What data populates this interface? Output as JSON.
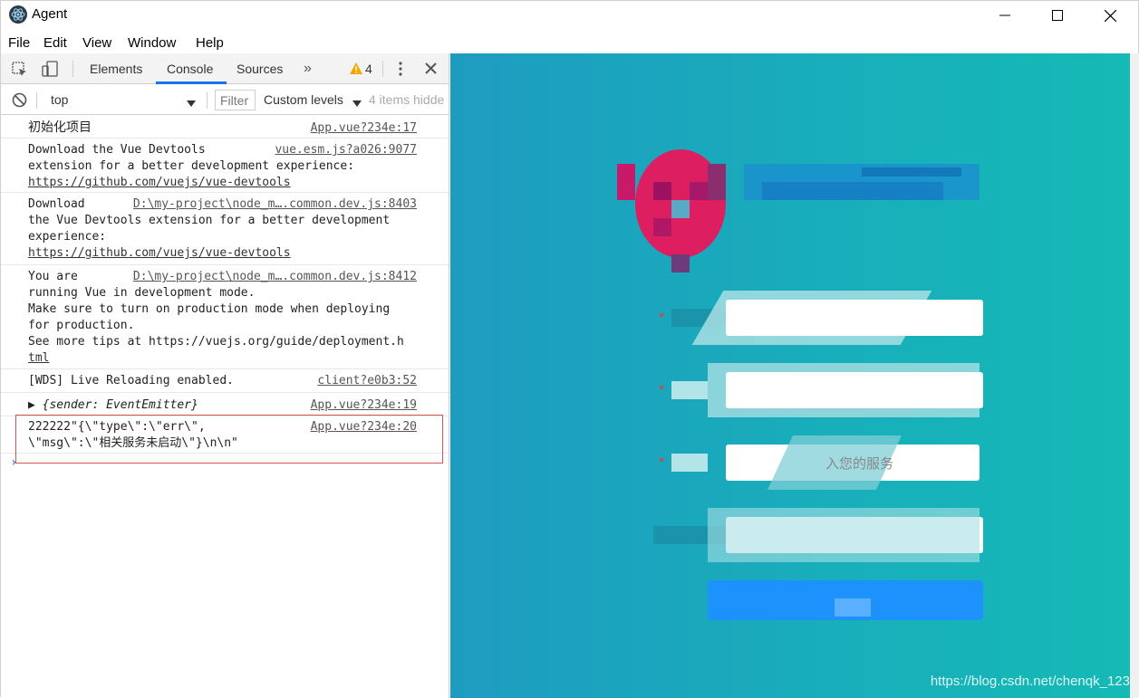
{
  "window": {
    "title": "Agent"
  },
  "menu": [
    "File",
    "Edit",
    "View",
    "Window",
    "Help"
  ],
  "devtools": {
    "tabs": [
      "Elements",
      "Console",
      "Sources"
    ],
    "active_tab": "Console",
    "warning_count": "4",
    "context": "top",
    "filter_placeholder": "Filter",
    "levels": "Custom levels",
    "hidden": "4 items hidde"
  },
  "console": {
    "messages": [
      {
        "text": "初始化项目",
        "source": "App.vue?234e:17"
      },
      {
        "lines": [
          "Download the Vue Devtools",
          "extension for a better development experience:",
          "https://github.com/vuejs/vue-devtools"
        ],
        "source": "vue.esm.js?a026:9077"
      },
      {
        "lines": [
          "Download",
          "the Vue Devtools extension for a better development",
          "experience:",
          "https://github.com/vuejs/vue-devtools"
        ],
        "source": "D:\\my-project\\node_m….common.dev.js:8403"
      },
      {
        "lines": [
          "You are",
          "running Vue in development mode.",
          "Make sure to turn on production mode when deploying",
          "for production.",
          "See more tips at https://vuejs.org/guide/deployment.h",
          "tml"
        ],
        "source": "D:\\my-project\\node_m….common.dev.js:8412"
      },
      {
        "text": "[WDS] Live Reloading enabled.",
        "source": "client?e0b3:52"
      },
      {
        "text": "▶ {sender: EventEmitter}",
        "source": "App.vue?234e:19"
      },
      {
        "lines": [
          "222222\"{\\\"type\\\":\\\"err\\\",",
          "\\\"msg\\\":\\\"相关服务未启动\\\"}\\n\\n\""
        ],
        "source": "App.vue?234e:20"
      }
    ]
  },
  "page": {
    "field_placeholder": "入您的服务",
    "watermark": "https://blog.csdn.net/chenqk_123",
    "colors": {
      "accent_pink": "#e8175d",
      "button_blue": "#1e90ff"
    }
  }
}
